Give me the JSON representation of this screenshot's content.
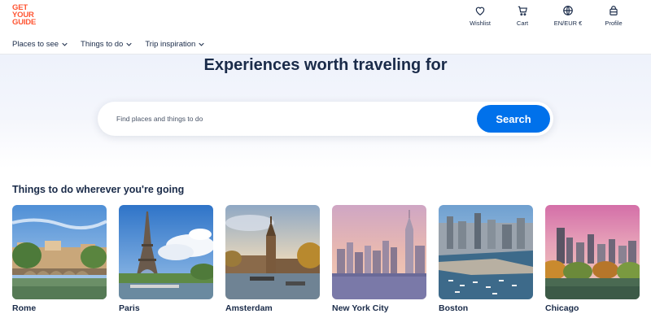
{
  "brand": {
    "logo_lines": [
      "GET",
      "YOUR",
      "GUIDE"
    ],
    "color": "#ff5533"
  },
  "header_nav": [
    {
      "label": "Wishlist",
      "icon": "heart-icon"
    },
    {
      "label": "Cart",
      "icon": "cart-icon"
    },
    {
      "label": "EN/EUR €",
      "icon": "globe-icon"
    },
    {
      "label": "Profile",
      "icon": "profile-icon"
    }
  ],
  "menu": [
    {
      "label": "Places to see"
    },
    {
      "label": "Things to do"
    },
    {
      "label": "Trip inspiration"
    }
  ],
  "hero": {
    "title": "Experiences worth traveling for",
    "search_placeholder": "Find places and things to do",
    "search_button": "Search"
  },
  "destinations": {
    "title": "Things to do wherever you're going",
    "items": [
      {
        "label": "Rome",
        "image": "rome-photo"
      },
      {
        "label": "Paris",
        "image": "paris-photo"
      },
      {
        "label": "Amsterdam",
        "image": "amsterdam-photo"
      },
      {
        "label": "New York City",
        "image": "new-york-photo"
      },
      {
        "label": "Boston",
        "image": "boston-photo"
      },
      {
        "label": "Chicago",
        "image": "chicago-photo"
      }
    ]
  },
  "colors": {
    "accent": "#0071eb",
    "text": "#1a2b49",
    "brand": "#ff5533"
  }
}
